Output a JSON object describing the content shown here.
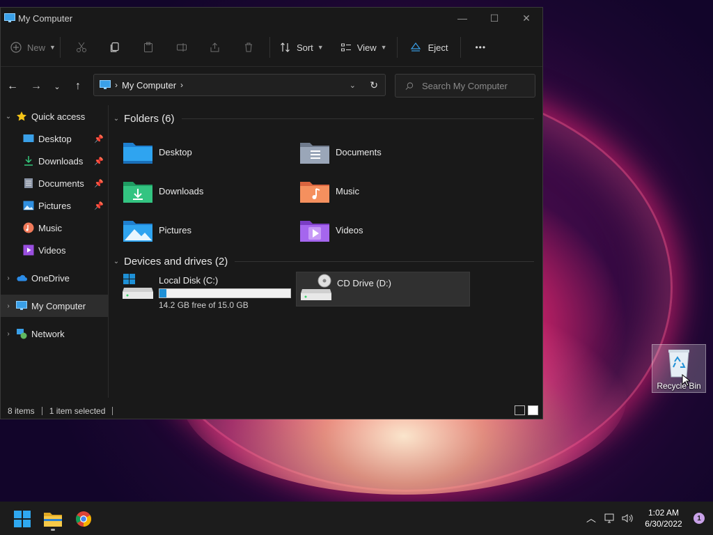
{
  "window": {
    "title": "My Computer",
    "controls": {
      "minimize": "—",
      "maximize": "☐",
      "close": "✕"
    }
  },
  "toolbar": {
    "new_label": "New",
    "sort_label": "Sort",
    "view_label": "View",
    "eject_label": "Eject",
    "more_label": "•••"
  },
  "address": {
    "crumb": "My Computer",
    "search_placeholder": "Search My Computer"
  },
  "nav": {
    "quick_access": "Quick access",
    "items": [
      {
        "label": "Desktop",
        "icon": "desktop-icon",
        "pinned": true
      },
      {
        "label": "Downloads",
        "icon": "downloads-icon",
        "pinned": true
      },
      {
        "label": "Documents",
        "icon": "documents-icon",
        "pinned": true
      },
      {
        "label": "Pictures",
        "icon": "pictures-icon",
        "pinned": true
      },
      {
        "label": "Music",
        "icon": "music-icon",
        "pinned": false
      },
      {
        "label": "Videos",
        "icon": "videos-icon",
        "pinned": false
      }
    ],
    "onedrive": "OneDrive",
    "my_computer": "My Computer",
    "network": "Network"
  },
  "content": {
    "folders_header": "Folders (6)",
    "folders": [
      {
        "label": "Desktop",
        "icon": "desktop-folder-icon"
      },
      {
        "label": "Documents",
        "icon": "documents-folder-icon"
      },
      {
        "label": "Downloads",
        "icon": "downloads-folder-icon"
      },
      {
        "label": "Music",
        "icon": "music-folder-icon"
      },
      {
        "label": "Pictures",
        "icon": "pictures-folder-icon"
      },
      {
        "label": "Videos",
        "icon": "videos-folder-icon"
      }
    ],
    "drives_header": "Devices and drives (2)",
    "drives": [
      {
        "label": "Local Disk (C:)",
        "free_text": "14.2 GB free of 15.0 GB",
        "used_fraction": 0.053
      },
      {
        "label": "CD Drive (D:)"
      }
    ]
  },
  "status": {
    "items": "8 items",
    "selected": "1 item selected"
  },
  "desktop": {
    "recycle_bin": "Recycle Bin"
  },
  "taskbar": {
    "time": "1:02 AM",
    "date": "6/30/2022",
    "notifications": "1"
  },
  "colors": {
    "accent": "#1e90d6",
    "window_bg": "#191919",
    "taskbar_bg": "#1c1c1c"
  }
}
